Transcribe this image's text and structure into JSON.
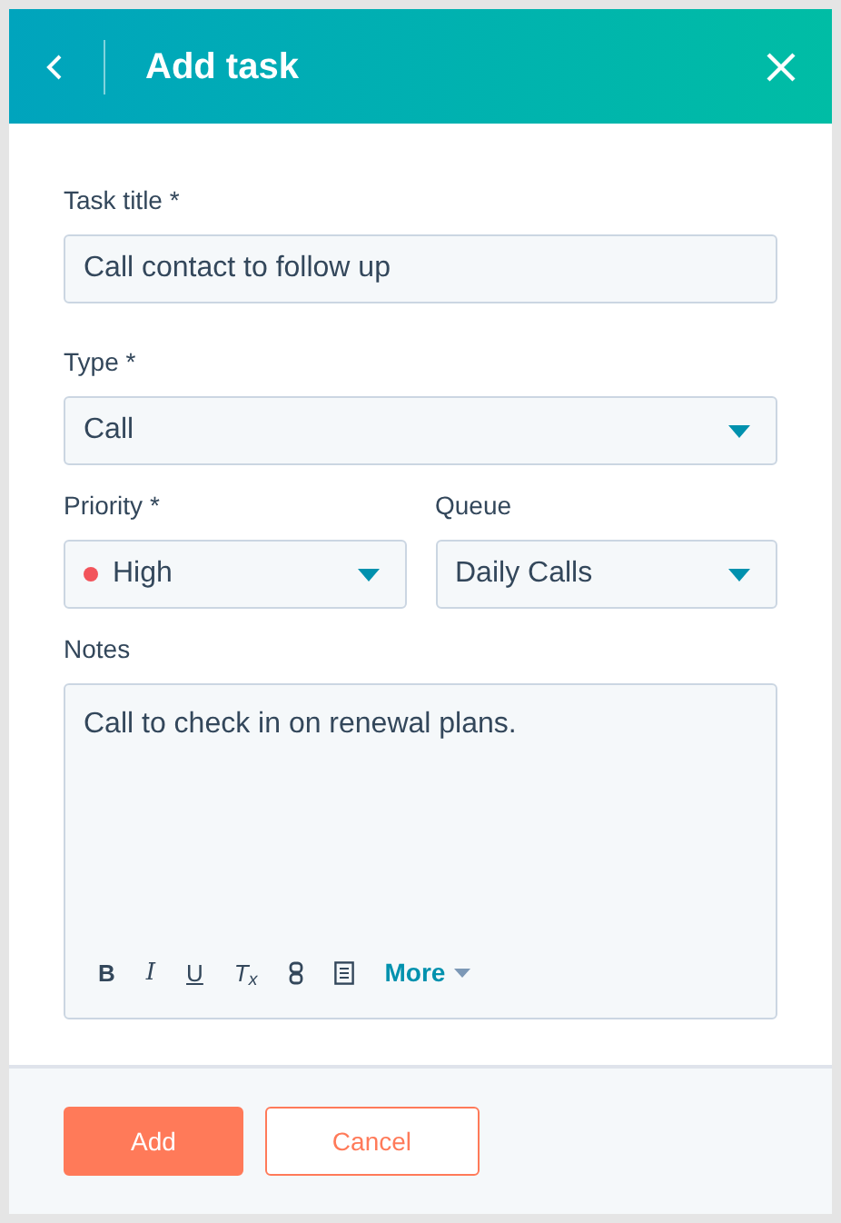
{
  "header": {
    "title": "Add task"
  },
  "fields": {
    "task_title": {
      "label": "Task title *",
      "value": "Call contact to follow up"
    },
    "type": {
      "label": "Type *",
      "value": "Call"
    },
    "priority": {
      "label": "Priority *",
      "value": "High",
      "color": "#f2545b"
    },
    "queue": {
      "label": "Queue",
      "value": "Daily Calls"
    },
    "notes": {
      "label": "Notes",
      "value": "Call to check in on renewal plans."
    }
  },
  "toolbar": [
    {
      "kind": "bold",
      "label": "B"
    },
    {
      "kind": "italic",
      "label": "I"
    },
    {
      "kind": "underline",
      "label": "U"
    },
    {
      "kind": "clear",
      "label": "T$_{x}$"
    },
    {
      "kind": "link"
    },
    {
      "kind": "document"
    },
    {
      "kind": "more",
      "label": "More"
    }
  ],
  "footer": {
    "buttons": [
      {
        "label": "Add",
        "kind": "primary"
      },
      {
        "label": "Cancel",
        "kind": "secondary"
      }
    ]
  }
}
